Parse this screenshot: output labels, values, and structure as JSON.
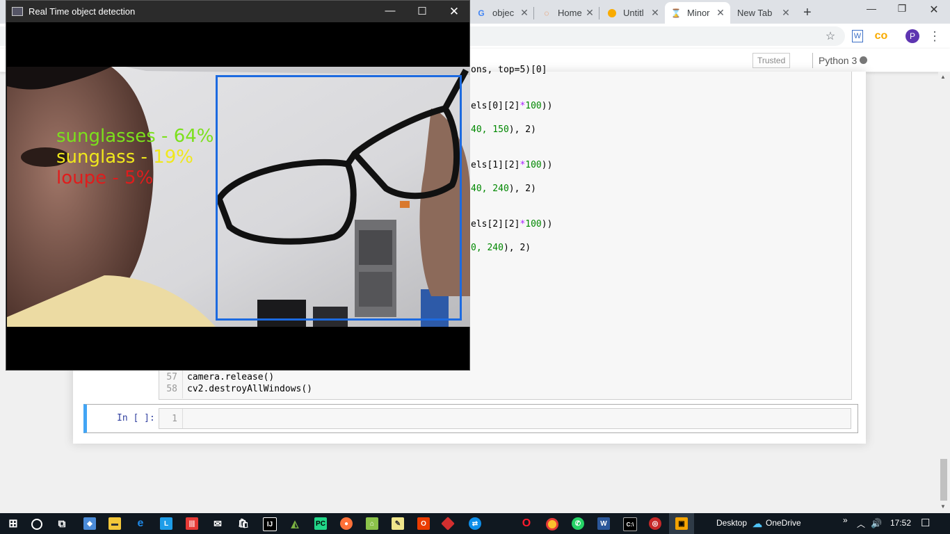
{
  "browser": {
    "tabs": [
      {
        "label": "objec",
        "icon": "google-icon",
        "color": "#4285f4"
      },
      {
        "label": "Home",
        "icon": "jupyter-icon",
        "color": "#f37726"
      },
      {
        "label": "Untitl",
        "icon": "colab-icon",
        "color": "#f9ab00"
      },
      {
        "label": "Minor",
        "icon": "hourglass-icon",
        "color": "#f37726"
      },
      {
        "label": "New Tab",
        "icon": "",
        "color": ""
      }
    ],
    "new_tab": "+",
    "profile_initial": "P"
  },
  "notebook": {
    "trusted": "Trusted",
    "kernel": "Python 3",
    "code_fragments": [
      {
        "pre": "ons, top=5)[0]",
        "num": "",
        "post": ""
      },
      {
        "pre": "els[0][2]",
        "op": "*",
        "num": "100",
        "post": "))"
      },
      {
        "pre": "",
        "num": "40, 150",
        "post": "), 2)"
      },
      {
        "pre": "els[1][2]",
        "op": "*",
        "num": "100",
        "post": "))"
      },
      {
        "pre": "",
        "num": "40, 240",
        "post": "), 2)"
      },
      {
        "pre": "els[2][2]",
        "op": "*",
        "num": "100",
        "post": "))"
      },
      {
        "pre": "",
        "num": "0, 240",
        "post": "), 2)"
      }
    ],
    "line57_num": "57",
    "line57": "camera.release()",
    "line58_num": "58",
    "line58": "cv2.destroyAllWindows()",
    "empty_prompt": "In [ ]:",
    "empty_line_num": "1"
  },
  "cv_window": {
    "title": "Real Time object detection",
    "detections": [
      {
        "label": "sunglasses - 64%",
        "color": "#7ce01c"
      },
      {
        "label": "sunglass - 19%",
        "color": "#f0e81c"
      },
      {
        "label": "loupe - 5%",
        "color": "#e01c1c"
      }
    ],
    "box_color": "#1c6ae0"
  },
  "taskbar": {
    "desktop": "Desktop",
    "onedrive": "OneDrive",
    "time": "17:52"
  }
}
